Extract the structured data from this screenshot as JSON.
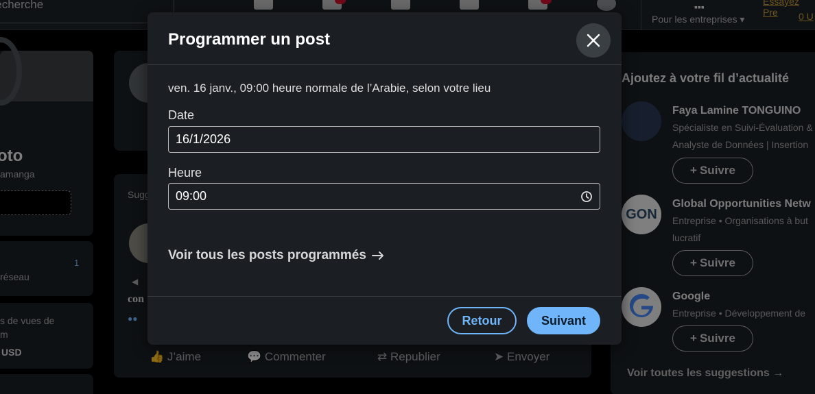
{
  "topnav": {
    "search_placeholder": "Recherche",
    "for_business_label": "Pour les entreprises ▾",
    "premium_label": "Essayez Pre",
    "premium_label_2": "0 U"
  },
  "left_profile": {
    "name": "oto",
    "location": "amanga",
    "network_label": "réseau",
    "network_count": "1",
    "views_label": "s de vues de",
    "views_label_2": "m",
    "amount": "USD"
  },
  "feed": {
    "suggestions_prefix": "Sugg",
    "post_snippet": "con",
    "actions": {
      "like": "J’aime",
      "comment": "Commenter",
      "repost": "Republier",
      "send": "Envoyer"
    }
  },
  "right_panel": {
    "title": "Ajoutez à votre fil d’actualité",
    "suggestions": [
      {
        "name": "Faya Lamine TONGUINO",
        "line1": "Spécialiste en Suivi-Évaluation &",
        "line2": "Analyste de Données | Insertion",
        "follow": "Suivre"
      },
      {
        "name": "Global Opportunities Netw",
        "line1": "Entreprise • Organisations à but",
        "line2": "lucratif",
        "logo_text": "GON",
        "follow": "Suivre"
      },
      {
        "name": "Google",
        "line1": "Entreprise • Développement de",
        "follow": "Suivre"
      }
    ],
    "see_all": "Voir toutes les suggestions →"
  },
  "modal": {
    "title": "Programmer un post",
    "timezone_text": "ven. 16 janv., 09:00 heure normale de l’Arabie, selon votre lieu",
    "date_label": "Date",
    "date_value": "16/1/2026",
    "time_label": "Heure",
    "time_value": "09:00",
    "see_all_scheduled": "Voir tous les posts programmés",
    "back_button": "Retour",
    "next_button": "Suivant"
  },
  "colors": {
    "accent": "#70b5f9",
    "background": "#000000",
    "card": "#1b1f23"
  }
}
